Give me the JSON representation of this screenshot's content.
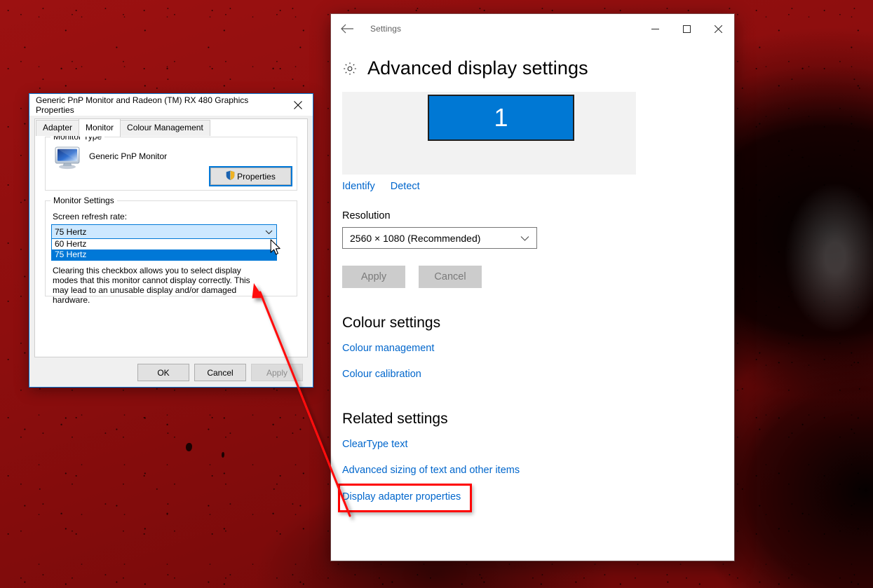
{
  "desktop": {
    "wallpaper_label": "dark-red-grunge-wallpaper"
  },
  "settings_window": {
    "titlebar": {
      "back_icon": "back-arrow-icon",
      "title": "Settings",
      "minimize_label": "Minimise",
      "maximize_label": "Maximise",
      "close_label": "Close"
    },
    "page": {
      "gear_icon": "gear-icon",
      "heading": "Advanced display settings",
      "display_tile_number": "1",
      "identify_link": "Identify",
      "detect_link": "Detect",
      "resolution_label": "Resolution",
      "resolution_value": "2560 × 1080 (Recommended)",
      "apply_button": "Apply",
      "cancel_button": "Cancel",
      "colour_settings_heading": "Colour settings",
      "colour_links": [
        "Colour management",
        "Colour calibration"
      ],
      "related_settings_heading": "Related settings",
      "related_links": [
        "ClearType text",
        "Advanced sizing of text and other items"
      ],
      "highlighted_link": "Display adapter properties"
    }
  },
  "properties_dialog": {
    "title": "Generic PnP Monitor and Radeon (TM) RX 480 Graphics Properties",
    "close_label": "Close",
    "tabs": [
      {
        "label": "Adapter",
        "active": false
      },
      {
        "label": "Monitor",
        "active": true
      },
      {
        "label": "Colour Management",
        "active": false
      }
    ],
    "monitor_type": {
      "legend": "Monitor Type",
      "icon": "monitor-icon",
      "name": "Generic PnP Monitor",
      "properties_button": "Properties",
      "properties_shield_icon": "uac-shield-icon"
    },
    "monitor_settings": {
      "legend": "Monitor Settings",
      "refresh_label": "Screen refresh rate:",
      "selected_value": "75 Hertz",
      "options": [
        {
          "label": "60 Hertz",
          "selected": false
        },
        {
          "label": "75 Hertz",
          "selected": true
        }
      ],
      "warning": "Clearing this checkbox allows you to select display modes that this monitor cannot display correctly. This may lead to an unusable display and/or damaged hardware."
    },
    "buttons": [
      {
        "label": "OK",
        "disabled": false
      },
      {
        "label": "Cancel",
        "disabled": false
      },
      {
        "label": "Apply",
        "disabled": true
      }
    ]
  },
  "annotation": {
    "arrow_label": "red-annotation-arrow",
    "box_label": "red-annotation-box",
    "colour": "#ff0000"
  },
  "cursor": {
    "label": "mouse-pointer"
  },
  "colors": {
    "accent_blue": "#0078d7",
    "link_blue": "#0066cc",
    "tile_blue": "#0078d4",
    "annotation_red": "#ff0000",
    "wallpaper_red": "#8d0e0e"
  }
}
